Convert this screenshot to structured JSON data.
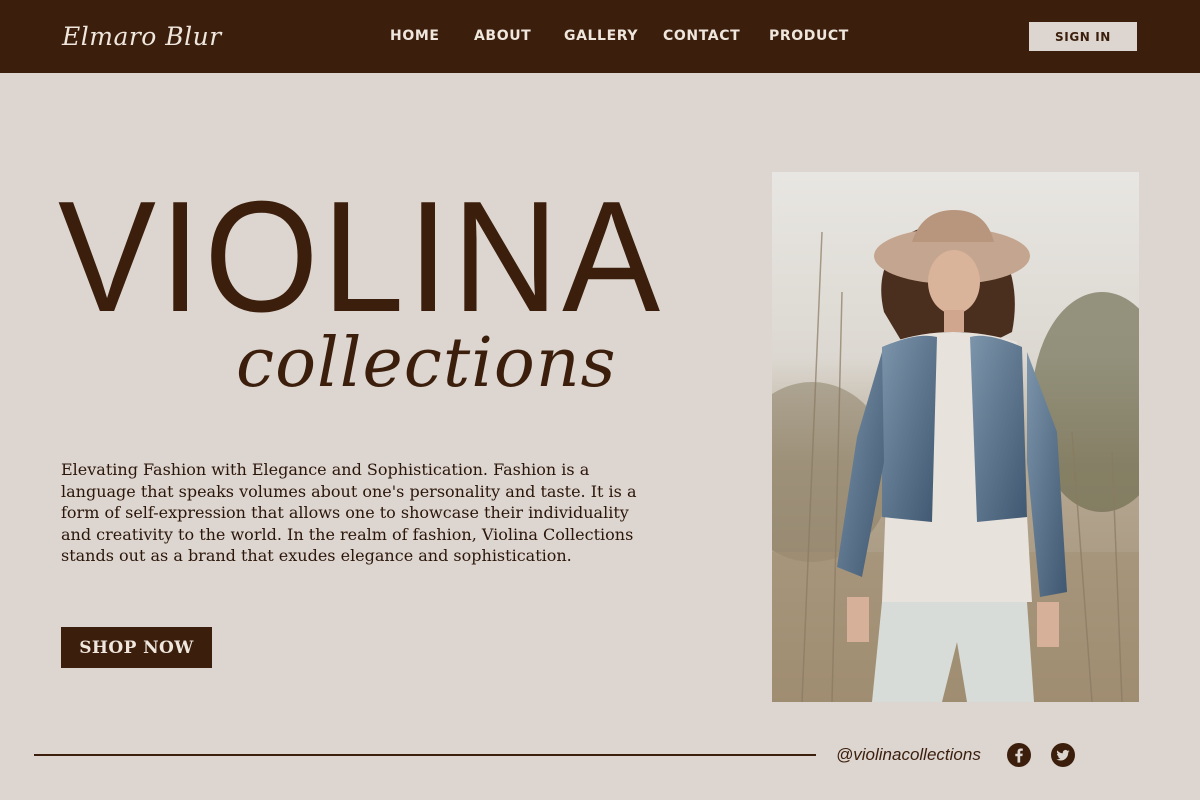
{
  "header": {
    "brand": "Elmaro Blur",
    "nav": [
      {
        "label": "HOME"
      },
      {
        "label": "ABOUT"
      },
      {
        "label": "GALLERY"
      },
      {
        "label": "CONTACT"
      },
      {
        "label": "PRODUCT"
      }
    ],
    "sign_in_label": "SIGN IN"
  },
  "hero": {
    "title": "VIOLINA",
    "subtitle": "collections",
    "body": "Elevating Fashion with Elegance and Sophistication. Fashion is a language that speaks volumes about one's personality and taste. It is a form of self-expression that allows one to showcase their individuality and creativity to the world. In the realm of fashion, Violina Collections stands out as a brand that exudes elegance and sophistication.",
    "cta_label": "SHOP NOW"
  },
  "footer": {
    "handle": "@violinacollections",
    "social": [
      {
        "icon": "facebook-icon"
      },
      {
        "icon": "twitter-icon"
      }
    ]
  },
  "colors": {
    "brand_brown": "#3b1f0c",
    "background": "#ddd5cf",
    "light_text": "#efe6dd"
  }
}
